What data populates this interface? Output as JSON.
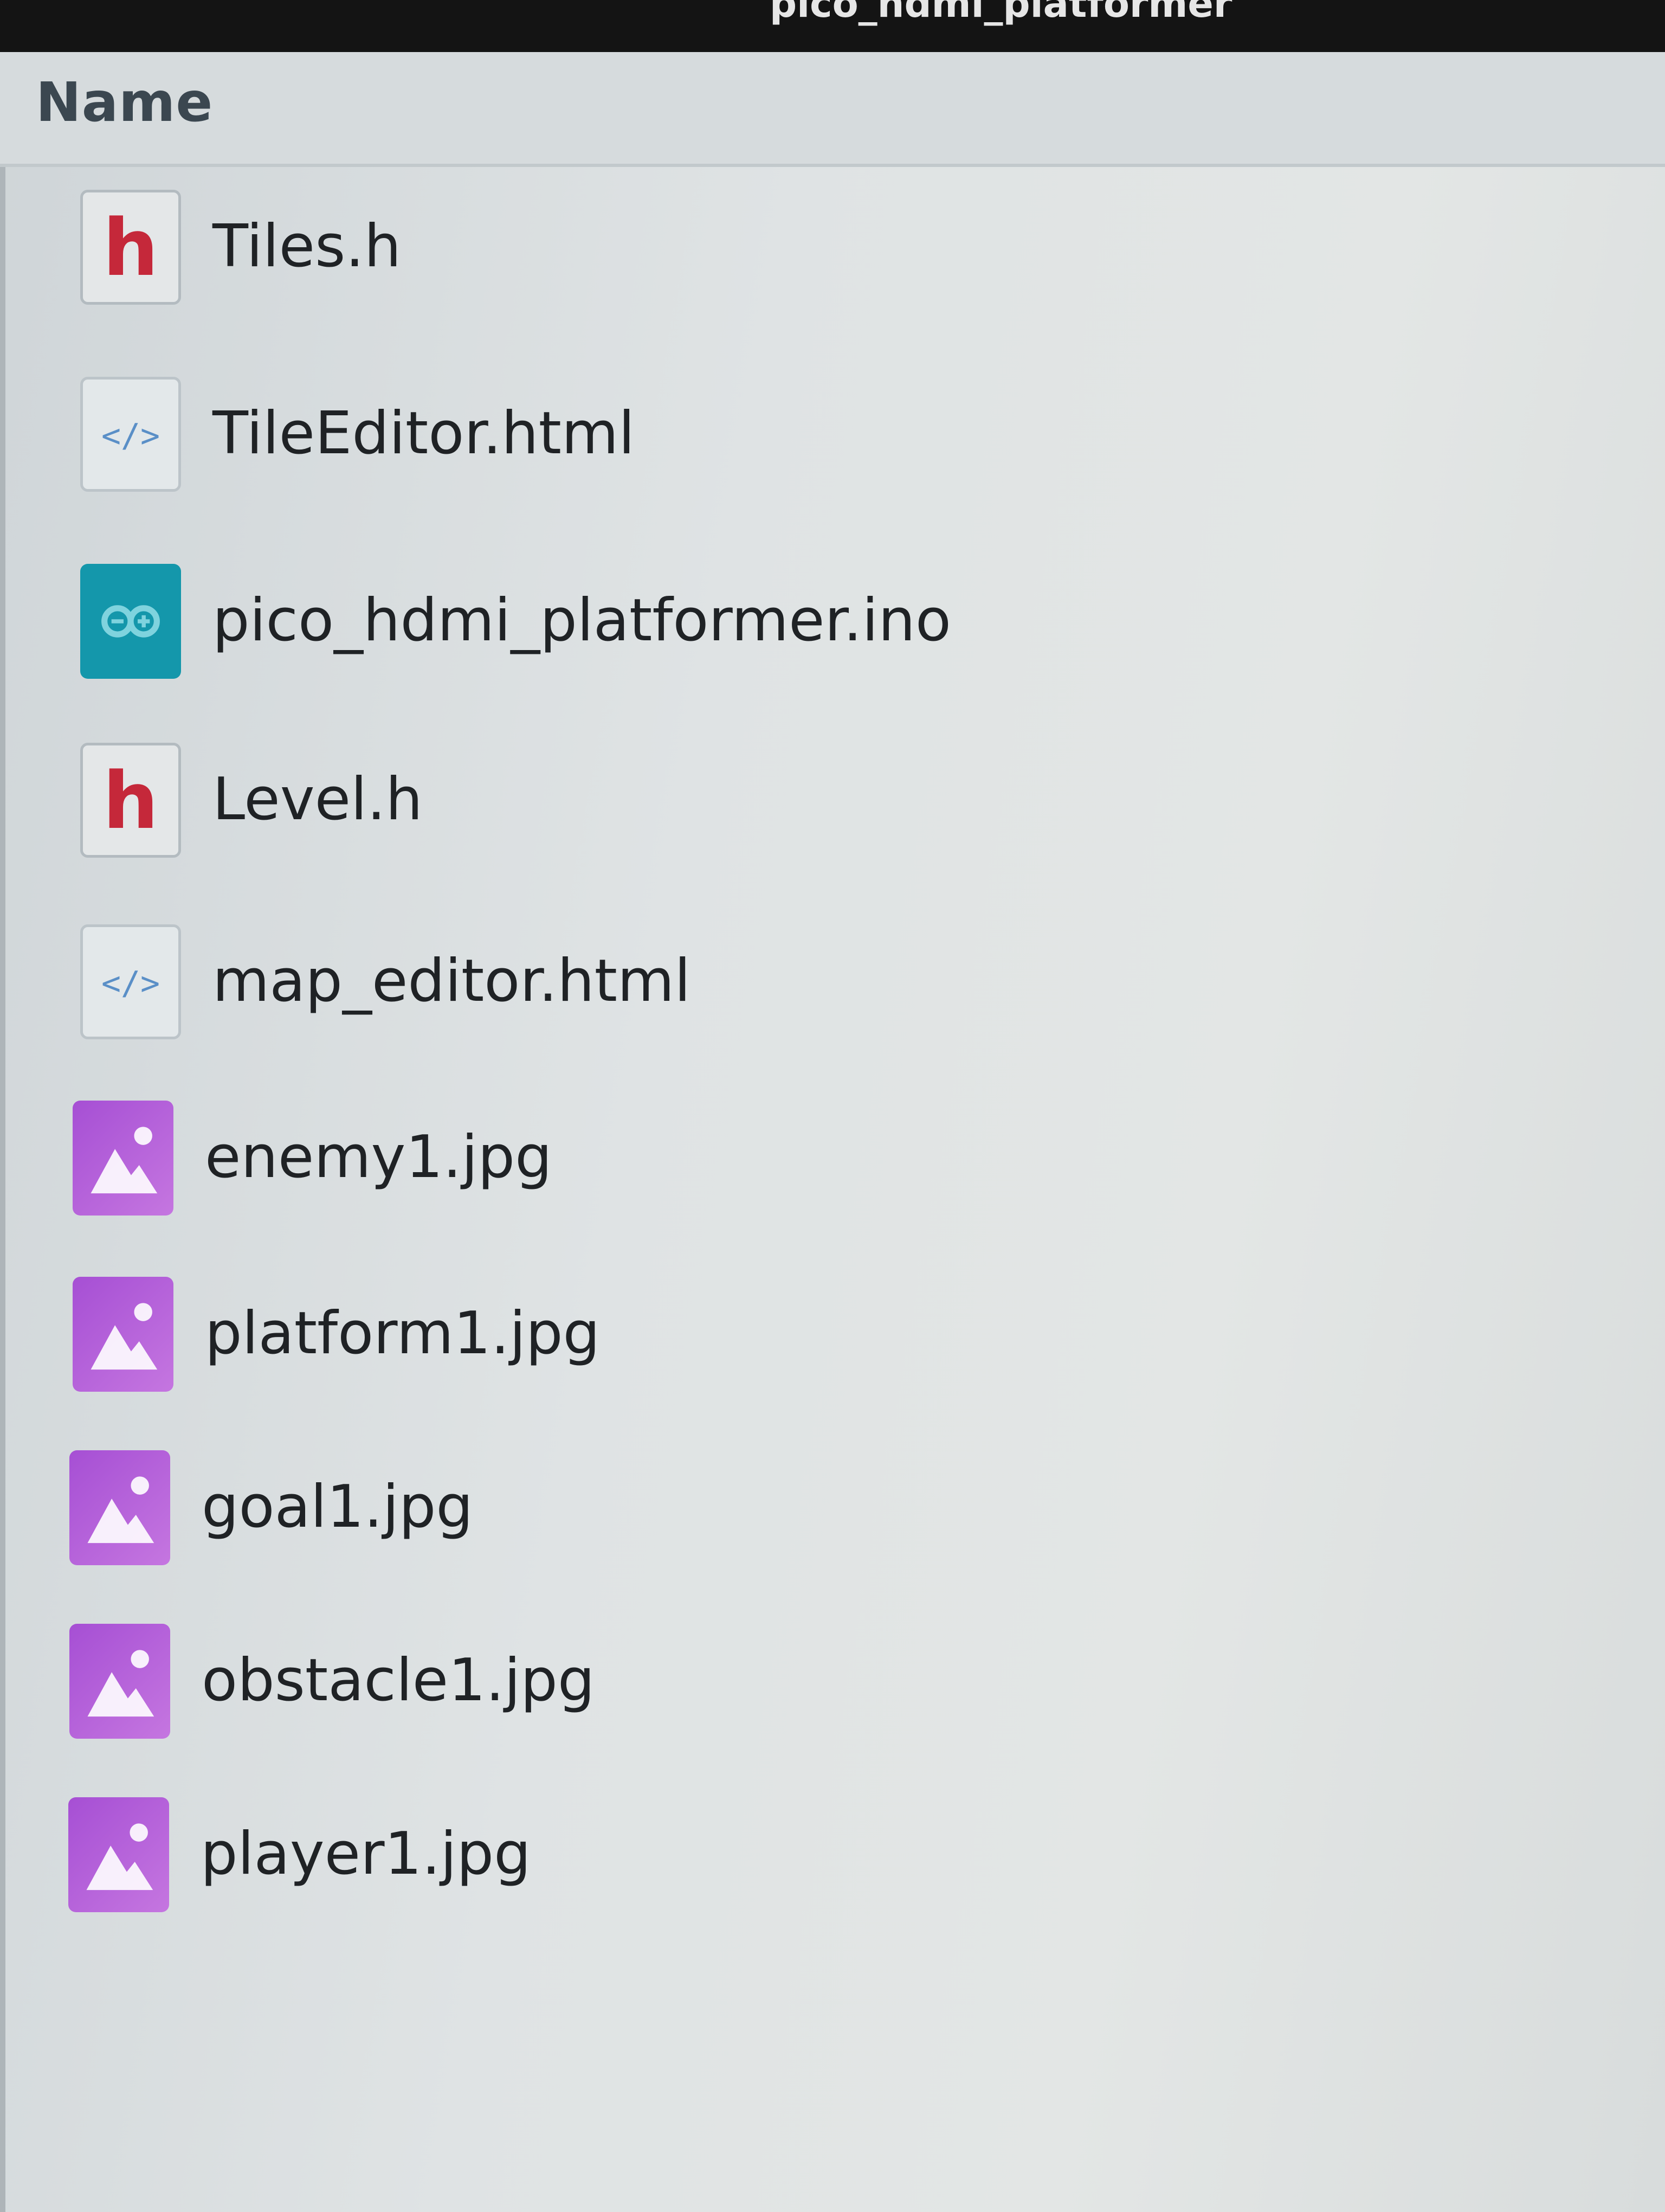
{
  "window": {
    "title": "pico_hdmi_platformer"
  },
  "columns": {
    "name_header": "Name"
  },
  "files": [
    {
      "name": "Tiles.h",
      "icon": "c-header-file-icon",
      "type": "header"
    },
    {
      "name": "TileEditor.html",
      "icon": "html-file-icon",
      "type": "html"
    },
    {
      "name": "pico_hdmi_platformer.ino",
      "icon": "arduino-file-icon",
      "type": "ino"
    },
    {
      "name": "Level.h",
      "icon": "c-header-file-icon",
      "type": "header"
    },
    {
      "name": "map_editor.html",
      "icon": "html-file-icon",
      "type": "html"
    },
    {
      "name": "enemy1.jpg",
      "icon": "image-file-icon",
      "type": "image"
    },
    {
      "name": "platform1.jpg",
      "icon": "image-file-icon",
      "type": "image"
    },
    {
      "name": "goal1.jpg",
      "icon": "image-file-icon",
      "type": "image"
    },
    {
      "name": "obstacle1.jpg",
      "icon": "image-file-icon",
      "type": "image"
    },
    {
      "name": "player1.jpg",
      "icon": "image-file-icon",
      "type": "image"
    }
  ],
  "colors": {
    "header_icon_letter": "#c5283a",
    "html_icon_tint": "#5a8fc7",
    "arduino_icon_bg": "#1497ab",
    "image_icon_bg": "#b45ed9",
    "text": "#1f2225"
  }
}
